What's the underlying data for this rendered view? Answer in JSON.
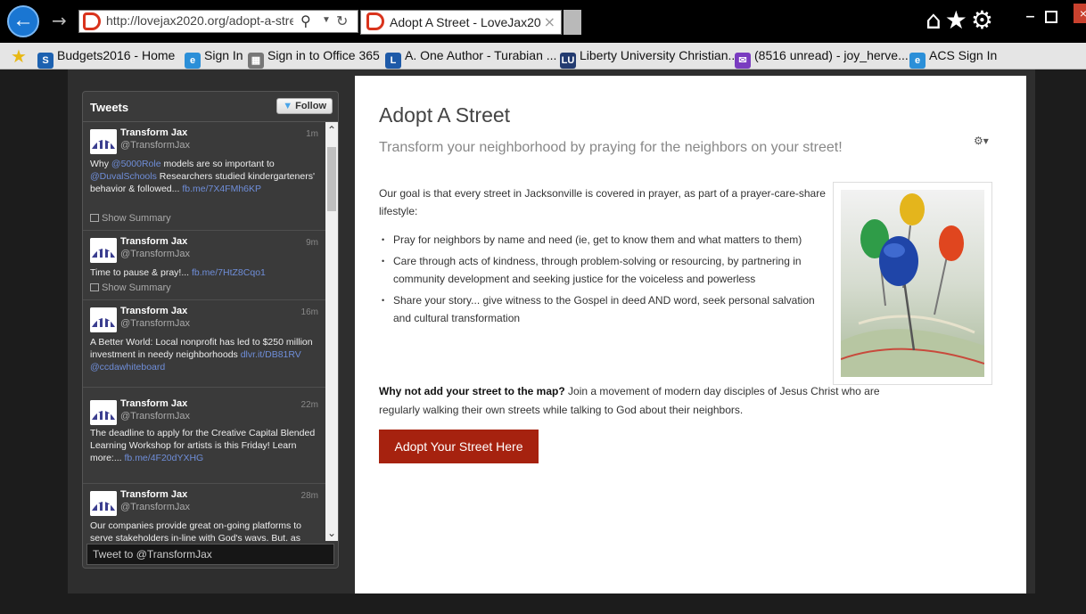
{
  "browser": {
    "address_url": "http://lovejax2020.org/adopt-a-stre",
    "tab_title": "Adopt A Street - LoveJax20...",
    "window_controls": [
      "home-icon",
      "star-icon",
      "gear-icon"
    ]
  },
  "favorites": [
    {
      "label": "Budgets2016 - Home",
      "icon": "sharepoint-icon",
      "color": "#1c61b0"
    },
    {
      "label": "Sign In",
      "icon": "ie-icon",
      "color": "#2b8fd8"
    },
    {
      "label": "Sign in to Office 365",
      "icon": "building-icon",
      "color": "#777777"
    },
    {
      "label": "A. One Author - Turabian ...",
      "icon": "doc-icon",
      "color": "#1e5aa8"
    },
    {
      "label": "Liberty University Christian...",
      "icon": "lu-icon",
      "color": "#233b70"
    },
    {
      "label": "(8516 unread) - joy_herve...",
      "icon": "mail-icon",
      "color": "#7a3cc0"
    },
    {
      "label": "ACS Sign In",
      "icon": "ie-icon",
      "color": "#2b8fd8"
    }
  ],
  "twitter": {
    "header": "Tweets",
    "follow_label": "Follow",
    "compose_placeholder": "Tweet to @TransformJax",
    "summary_label": "Show Summary",
    "tweets": [
      {
        "name": "Transform Jax",
        "handle": "@TransformJax",
        "time": "1m",
        "text_parts": [
          "Why ",
          "@5000Role",
          " models are so important to ",
          "@DuvalSchools",
          " Researchers studied kindergarteners' behavior & followed... ",
          "fb.me/7X4FMh6KP"
        ],
        "show_summary": true
      },
      {
        "name": "Transform Jax",
        "handle": "@TransformJax",
        "time": "9m",
        "text_parts": [
          "Time to pause & pray!... ",
          "fb.me/7HtZ8Cqo1"
        ],
        "show_summary": true
      },
      {
        "name": "Transform Jax",
        "handle": "@TransformJax",
        "time": "16m",
        "text_parts": [
          "A Better World: Local nonprofit has led to $250 million investment in needy neighborhoods ",
          "dlvr.it/DB81RV",
          " ",
          "@ccdawhiteboard"
        ],
        "show_summary": false
      },
      {
        "name": "Transform Jax",
        "handle": "@TransformJax",
        "time": "22m",
        "text_parts": [
          "The deadline to apply for the Creative Capital Blended Learning Workshop for artists is this Friday! Learn more:... ",
          "fb.me/4F20dYXHG"
        ],
        "show_summary": false
      },
      {
        "name": "Transform Jax",
        "handle": "@TransformJax",
        "time": "28m",
        "text_parts": [
          "Our companies provide great on-going platforms to serve stakeholders in-line with God's ways. But, as"
        ],
        "show_summary": false
      }
    ]
  },
  "main": {
    "title": "Adopt A Street",
    "subtitle": "Transform your neighborhood by praying for the neighbors on your street!",
    "intro": "Our goal is that every street in Jacksonville is covered in prayer, as part of a prayer-care-share lifestyle:",
    "bullets": [
      "Pray for neighbors by name and need (ie, get to know them and what matters to them)",
      "Care through acts of kindness, through problem-solving or resourcing, by partnering in community development and seeking justice for the voiceless and powerless",
      "Share your story... give witness to the Gospel in deed AND word, seek personal salvation and cultural transformation"
    ],
    "why_bold": "Why not add your street to the map?",
    "why_text": " Join a movement of modern day disciples of Jesus Christ who are regularly walking their own streets while talking to God about their neighbors.",
    "button_label": "Adopt Your Street Here"
  },
  "colors": {
    "accent_red": "#a6220f",
    "link_blue": "#6f8ed9",
    "ie_blue": "#1a76d2"
  }
}
